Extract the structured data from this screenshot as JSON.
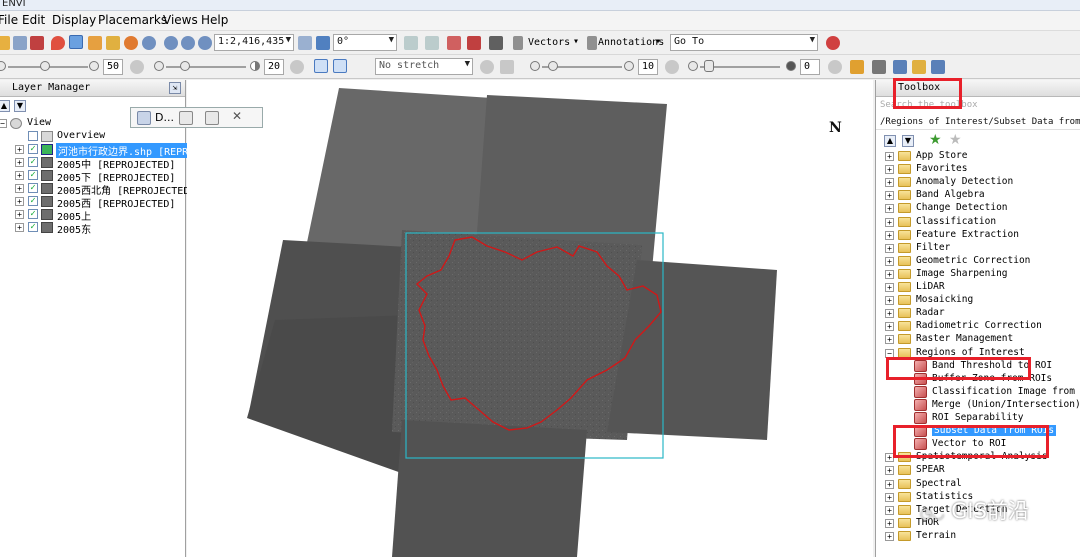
{
  "window": {
    "title": "ENVI"
  },
  "menu": {
    "items": [
      "File",
      "Edit",
      "Display",
      "Placemarks",
      "Views",
      "Help"
    ]
  },
  "toolbar1": {
    "scale_value": "1:2,416,435",
    "rotation_value": "0°",
    "vectors_label": "Vectors",
    "annotations_label": "Annotations",
    "goto_label": "Go To"
  },
  "toolbar2": {
    "brightness_value": "50",
    "contrast_value": "20",
    "stretch_value": "No stretch",
    "sharpen_value": "10",
    "transparency_value": "0"
  },
  "layer_manager": {
    "title": "Layer Manager",
    "root": "View",
    "overview": "Overview",
    "layers": [
      {
        "label": "河池市行政边界.shp [REPRO",
        "selected": true,
        "kind": "vector"
      },
      {
        "label": "2005中 [REPROJECTED]",
        "selected": false,
        "kind": "raster"
      },
      {
        "label": "2005下 [REPROJECTED]",
        "selected": false,
        "kind": "raster"
      },
      {
        "label": "2005西北角 [REPROJECTED]",
        "selected": false,
        "kind": "raster"
      },
      {
        "label": "2005西 [REPROJECTED]",
        "selected": false,
        "kind": "raster"
      },
      {
        "label": "2005上",
        "selected": false,
        "kind": "raster"
      },
      {
        "label": "2005东",
        "selected": false,
        "kind": "raster"
      }
    ]
  },
  "float_toolbar": {
    "label": "D..."
  },
  "map": {
    "north_label": "N"
  },
  "toolbox": {
    "title": "Toolbox",
    "search_placeholder": "Search the toolbox",
    "path": "/Regions of Interest/Subset Data from ROIs",
    "items": [
      {
        "label": "App Store",
        "type": "folder",
        "level": 0
      },
      {
        "label": "Favorites",
        "type": "folder",
        "level": 0
      },
      {
        "label": "Anomaly Detection",
        "type": "folder",
        "level": 0
      },
      {
        "label": "Band Algebra",
        "type": "folder",
        "level": 0
      },
      {
        "label": "Change Detection",
        "type": "folder",
        "level": 0
      },
      {
        "label": "Classification",
        "type": "folder",
        "level": 0
      },
      {
        "label": "Feature Extraction",
        "type": "folder",
        "level": 0
      },
      {
        "label": "Filter",
        "type": "folder",
        "level": 0
      },
      {
        "label": "Geometric Correction",
        "type": "folder",
        "level": 0
      },
      {
        "label": "Image Sharpening",
        "type": "folder",
        "level": 0
      },
      {
        "label": "LiDAR",
        "type": "folder",
        "level": 0
      },
      {
        "label": "Mosaicking",
        "type": "folder",
        "level": 0
      },
      {
        "label": "Radar",
        "type": "folder",
        "level": 0
      },
      {
        "label": "Radiometric Correction",
        "type": "folder",
        "level": 0
      },
      {
        "label": "Raster Management",
        "type": "folder",
        "level": 0
      },
      {
        "label": "Regions of Interest",
        "type": "folder",
        "level": 0
      },
      {
        "label": "Band Threshold to ROI",
        "type": "tool",
        "level": 1
      },
      {
        "label": "Buffer Zone from ROIs",
        "type": "tool",
        "level": 1
      },
      {
        "label": "Classification Image from ROIs",
        "type": "tool",
        "level": 1
      },
      {
        "label": "Merge (Union/Intersection) ROI",
        "type": "tool",
        "level": 1
      },
      {
        "label": "ROI Separability",
        "type": "tool",
        "level": 1
      },
      {
        "label": "Subset Data from ROIs",
        "type": "tool",
        "level": 1,
        "selected": true
      },
      {
        "label": "Vector to ROI",
        "type": "tool",
        "level": 1
      },
      {
        "label": "Spatiotemporal Analysis",
        "type": "folder",
        "level": 0
      },
      {
        "label": "SPEAR",
        "type": "folder",
        "level": 0
      },
      {
        "label": "Spectral",
        "type": "folder",
        "level": 0
      },
      {
        "label": "Statistics",
        "type": "folder",
        "level": 0
      },
      {
        "label": "Target Detection",
        "type": "folder",
        "level": 0
      },
      {
        "label": "THOR",
        "type": "folder",
        "level": 0
      },
      {
        "label": "Terrain",
        "type": "folder",
        "level": 0
      }
    ]
  },
  "watermark": {
    "text": "GIS前沿"
  },
  "colors": {
    "highlight": "#e8202a",
    "selection": "#3399ff",
    "roi_outline": "#2ab7c6",
    "boundary": "#d01818"
  }
}
